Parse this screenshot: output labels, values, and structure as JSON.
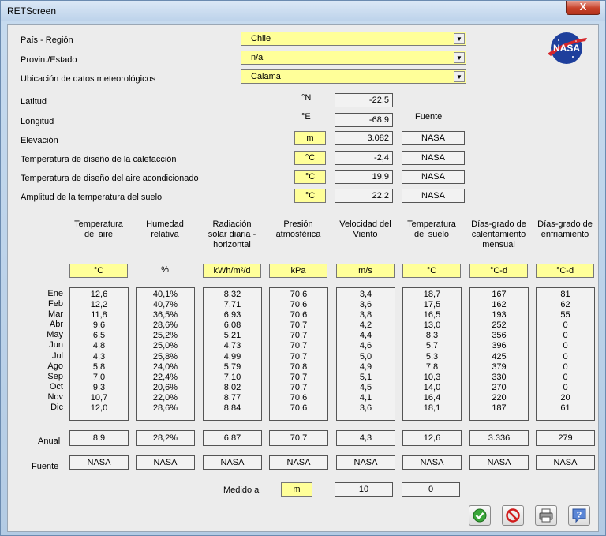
{
  "window": {
    "title": "RETScreen",
    "close_label": "X"
  },
  "location": {
    "country_label": "País - Región",
    "country_value": "Chile",
    "province_label": "Provin./Estado",
    "province_value": "n/a",
    "weather_label": "Ubicación de datos meteorológicos",
    "weather_value": "Calama"
  },
  "site": {
    "source_header": "Fuente",
    "rows": [
      {
        "label": "Latitud",
        "unit": "°N",
        "value": "-22,5",
        "source": ""
      },
      {
        "label": "Longitud",
        "unit": "°E",
        "value": "-68,9",
        "source": ""
      },
      {
        "label": "Elevación",
        "unit": "m",
        "value": "3.082",
        "source": "NASA"
      },
      {
        "label": "Temperatura de diseño de la calefacción",
        "unit": "°C",
        "value": "-2,4",
        "source": "NASA"
      },
      {
        "label": "Temperatura de diseño del aire acondicionado",
        "unit": "°C",
        "value": "19,9",
        "source": "NASA"
      },
      {
        "label": "Amplitud de la temperatura del suelo",
        "unit": "°C",
        "value": "22,2",
        "source": "NASA"
      }
    ]
  },
  "columns": [
    {
      "header": "Temperatura\ndel aire",
      "unit": "°C",
      "values": [
        "12,6",
        "12,2",
        "11,8",
        "9,6",
        "6,5",
        "4,8",
        "4,3",
        "5,8",
        "7,0",
        "9,3",
        "10,7",
        "12,0"
      ],
      "annual": "8,9",
      "source": "NASA"
    },
    {
      "header": "Humedad\nrelativa",
      "unit": "%",
      "values": [
        "40,1%",
        "40,7%",
        "36,5%",
        "28,6%",
        "25,2%",
        "25,0%",
        "25,8%",
        "24,0%",
        "22,4%",
        "20,6%",
        "22,0%",
        "28,6%"
      ],
      "annual": "28,2%",
      "source": "NASA"
    },
    {
      "header": "Radiación\nsolar diaria -\nhorizontal",
      "unit": "kWh/m²/d",
      "values": [
        "8,32",
        "7,71",
        "6,93",
        "6,08",
        "5,21",
        "4,73",
        "4,99",
        "5,79",
        "7,10",
        "8,02",
        "8,77",
        "8,84"
      ],
      "annual": "6,87",
      "source": "NASA"
    },
    {
      "header": "Presión\natmosférica",
      "unit": "kPa",
      "values": [
        "70,6",
        "70,6",
        "70,6",
        "70,7",
        "70,7",
        "70,7",
        "70,7",
        "70,8",
        "70,7",
        "70,7",
        "70,6",
        "70,6"
      ],
      "annual": "70,7",
      "source": "NASA"
    },
    {
      "header": "Velocidad del\nViento",
      "unit": "m/s",
      "values": [
        "3,4",
        "3,6",
        "3,8",
        "4,2",
        "4,4",
        "4,6",
        "5,0",
        "4,9",
        "5,1",
        "4,5",
        "4,1",
        "3,6"
      ],
      "annual": "4,3",
      "source": "NASA"
    },
    {
      "header": "Temperatura\ndel suelo",
      "unit": "°C",
      "values": [
        "18,7",
        "17,5",
        "16,5",
        "13,0",
        "8,3",
        "5,7",
        "5,3",
        "7,8",
        "10,3",
        "14,0",
        "16,4",
        "18,1"
      ],
      "annual": "12,6",
      "source": "NASA"
    },
    {
      "header": "Días-grado de\ncalentamiento\nmensual",
      "unit": "°C-d",
      "values": [
        "167",
        "162",
        "193",
        "252",
        "356",
        "396",
        "425",
        "379",
        "330",
        "270",
        "220",
        "187"
      ],
      "annual": "3.336",
      "source": "NASA"
    },
    {
      "header": "Días-grado de\nenfriamiento",
      "unit": "°C-d",
      "values": [
        "81",
        "62",
        "55",
        "0",
        "0",
        "0",
        "0",
        "0",
        "0",
        "0",
        "20",
        "61"
      ],
      "annual": "279",
      "source": "NASA"
    }
  ],
  "months": [
    "Ene",
    "Feb",
    "Mar",
    "Abr",
    "May",
    "Jun",
    "Jul",
    "Ago",
    "Sep",
    "Oct",
    "Nov",
    "Dic"
  ],
  "annual_label": "Anual",
  "source_label": "Fuente",
  "measured": {
    "label": "Medido a",
    "unit": "m",
    "value1": "10",
    "value2": "0"
  },
  "logo": {
    "text": "NASA"
  },
  "buttons": [
    {
      "icon": "check-icon"
    },
    {
      "icon": "cancel-icon"
    },
    {
      "icon": "printer-icon"
    },
    {
      "icon": "help-icon",
      "label": "?"
    }
  ]
}
